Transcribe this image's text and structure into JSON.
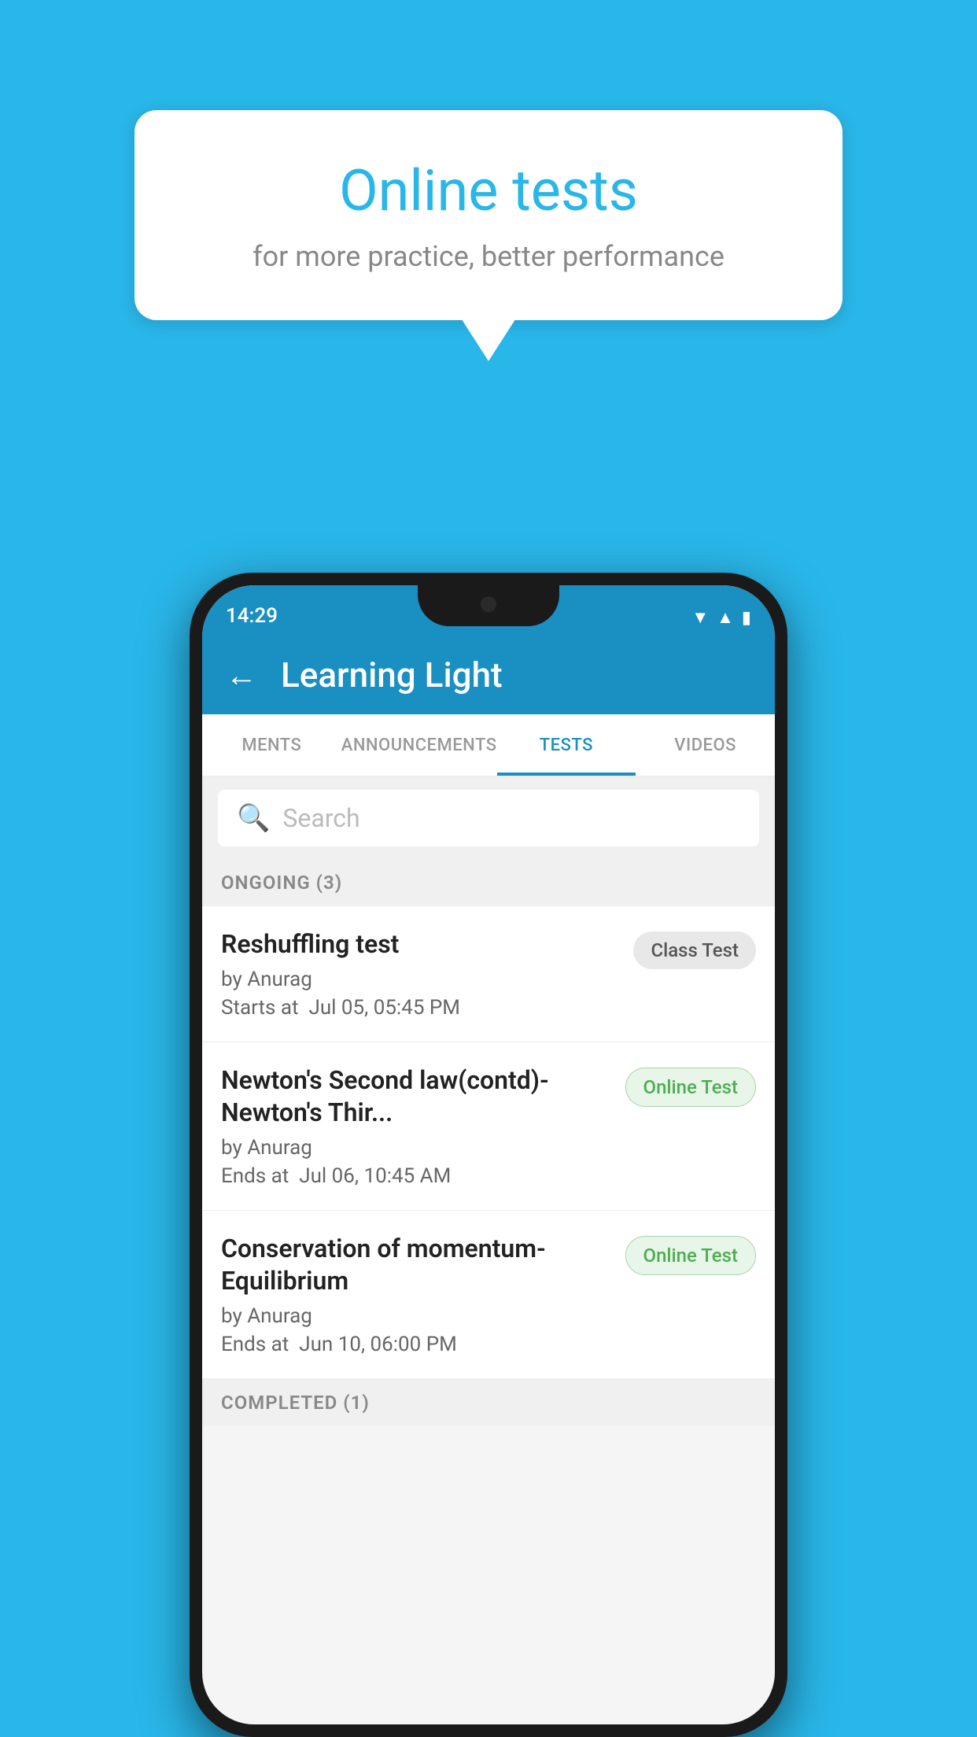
{
  "background_color": "#29b6e8",
  "speech_bubble": {
    "title": "Online tests",
    "subtitle": "for more practice, better performance"
  },
  "status_bar": {
    "time": "14:29",
    "icons": [
      "wifi",
      "signal",
      "battery"
    ]
  },
  "app_bar": {
    "back_label": "←",
    "title": "Learning Light"
  },
  "tabs": [
    {
      "label": "MENTS",
      "active": false
    },
    {
      "label": "ANNOUNCEMENTS",
      "active": false
    },
    {
      "label": "TESTS",
      "active": true
    },
    {
      "label": "VIDEOS",
      "active": false
    }
  ],
  "search": {
    "placeholder": "Search"
  },
  "ongoing_section": {
    "label": "ONGOING (3)"
  },
  "tests": [
    {
      "name": "Reshuffling test",
      "by": "by Anurag",
      "date_label": "Starts at",
      "date": "Jul 05, 05:45 PM",
      "badge": "Class Test",
      "badge_type": "class"
    },
    {
      "name": "Newton's Second law(contd)-Newton's Thir...",
      "by": "by Anurag",
      "date_label": "Ends at",
      "date": "Jul 06, 10:45 AM",
      "badge": "Online Test",
      "badge_type": "online"
    },
    {
      "name": "Conservation of momentum-Equilibrium",
      "by": "by Anurag",
      "date_label": "Ends at",
      "date": "Jun 10, 06:00 PM",
      "badge": "Online Test",
      "badge_type": "online"
    }
  ],
  "completed_section": {
    "label": "COMPLETED (1)"
  }
}
